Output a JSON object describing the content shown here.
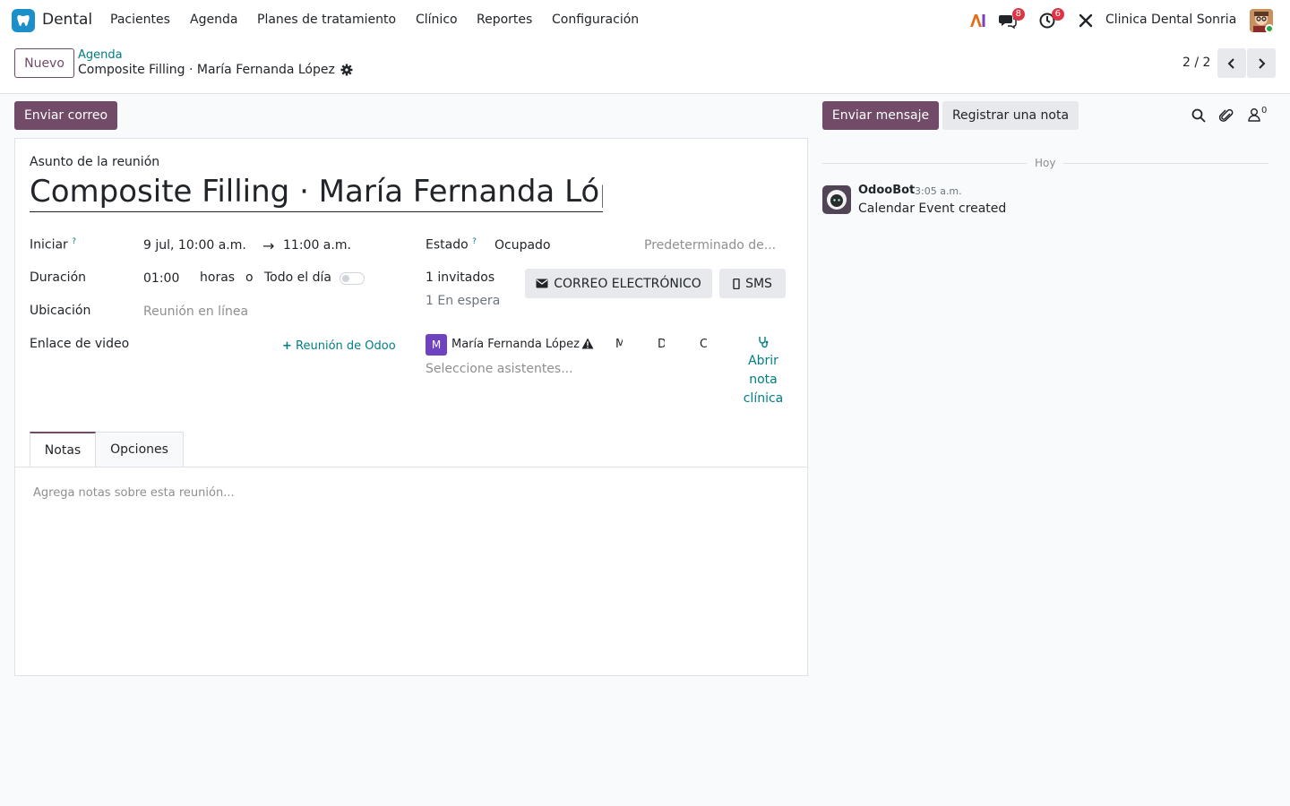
{
  "topnav": {
    "app_name": "Dental",
    "menu": [
      "Pacientes",
      "Agenda",
      "Planes de tratamiento",
      "Clínico",
      "Reportes",
      "Configuración"
    ],
    "messages_count": "8",
    "activities_count": "6",
    "company": "Clinica Dental Sonria"
  },
  "control": {
    "new_label": "Nuevo",
    "breadcrumb": "Agenda",
    "record_title": "Composite Filling · María Fernanda López",
    "pager": "2 / 2"
  },
  "actions": {
    "send_mail": "Enviar correo"
  },
  "form": {
    "subject_label": "Asunto de la reunión",
    "subject_value": "Composite Filling · María Fernanda López",
    "start_label": "Iniciar",
    "start_help": "?",
    "start_value": "9 jul, 10:00 a.m.",
    "arrow": "→",
    "end_value": "11:00 a.m.",
    "duration_label": "Duración",
    "duration_value": "01:00",
    "hours_label": "horas",
    "or_label": "o",
    "allday_label": "Todo el día",
    "location_label": "Ubicación",
    "location_placeholder": "Reunión en línea",
    "video_label": "Enlace de video",
    "odoo_meeting": "Reunión de Odoo",
    "state_label": "Estado",
    "state_help": "?",
    "state_value": "Ocupado",
    "privacy_placeholder": "Predeterminado de...",
    "invited": "1 invitados",
    "waiting": "1 En espera",
    "email_button": "CORREO ELECTRÓNICO",
    "sms_button": "SMS",
    "attendee_initial": "M",
    "attendee_name": "María Fernanda López",
    "attendee_cols": [
      "M",
      "D",
      "C"
    ],
    "attendees_placeholder": "Seleccione asistentes...",
    "clinical_note": [
      "Abrir",
      "nota",
      "clínica"
    ],
    "tabs": [
      "Notas",
      "Opciones"
    ],
    "notes_placeholder": "Agrega notas sobre esta reunión..."
  },
  "chatter": {
    "send_message": "Enviar mensaje",
    "log_note": "Registrar una nota",
    "followers_count": "0",
    "day": "Hoy",
    "author": "OdooBot",
    "time": "3:05 a.m.",
    "body": "Calendar Event created"
  },
  "colors": {
    "primary": "#714b67",
    "link": "#017e84",
    "badge": "#dc3545"
  }
}
